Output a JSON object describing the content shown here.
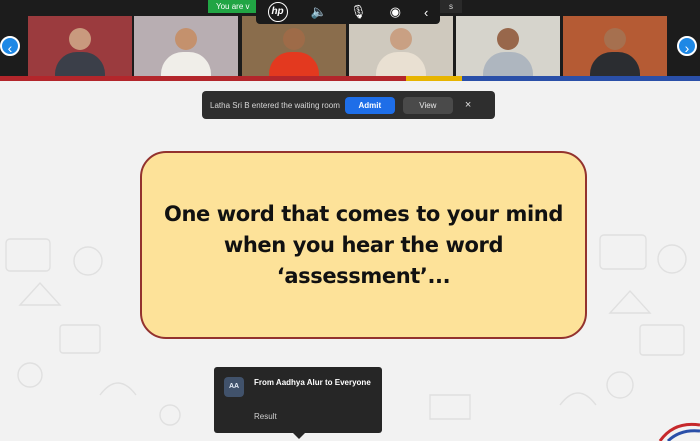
{
  "meeting": {
    "you_badge": "You are v",
    "s_badge": "s"
  },
  "hp_toolbar": {
    "logo": "hp",
    "items": [
      {
        "name": "volume-icon",
        "glyph": "🔈"
      },
      {
        "name": "microphone-icon",
        "glyph": "🎙"
      },
      {
        "name": "camera-privacy-icon",
        "glyph": "◉"
      },
      {
        "name": "collapse-icon",
        "glyph": "‹"
      }
    ]
  },
  "gallery": {
    "prev_glyph": "‹",
    "next_glyph": "›",
    "tiles": [
      {
        "name": "participant-tile-1",
        "bg": "#9b3b3e",
        "skin": "#c99a7e",
        "cloth": "#3b3f49"
      },
      {
        "name": "participant-tile-2",
        "bg": "#b8aeb2",
        "skin": "#c4916d",
        "cloth": "#f0eee9"
      },
      {
        "name": "participant-tile-3",
        "bg": "#8a6d4c",
        "skin": "#9e6b48",
        "cloth": "#e3391f"
      },
      {
        "name": "participant-tile-4",
        "bg": "#cfc9be",
        "skin": "#c9a083",
        "cloth": "#e9e0d2"
      },
      {
        "name": "participant-tile-5",
        "bg": "#d6d4cc",
        "skin": "#98674b",
        "cloth": "#aeb6bf"
      },
      {
        "name": "participant-tile-6",
        "bg": "#b55b34",
        "skin": "#a6704f",
        "cloth": "#2b2d31"
      }
    ]
  },
  "waiting_room": {
    "message": "Latha Sri B entered the waiting room",
    "admit_label": "Admit",
    "view_label": "View",
    "close_glyph": "×"
  },
  "slide": {
    "line1": "One word that comes to your mind",
    "line2": "when you hear the word",
    "line3": "‘assessment’..."
  },
  "chat": {
    "avatar": "AA",
    "from": "From Aadhya Alur to Everyone",
    "message": "Result"
  },
  "colors": {
    "card_fill": "#fde299",
    "card_border": "#93322e",
    "admit_blue": "#1e6ee8",
    "nav_blue": "#1e88e5"
  }
}
